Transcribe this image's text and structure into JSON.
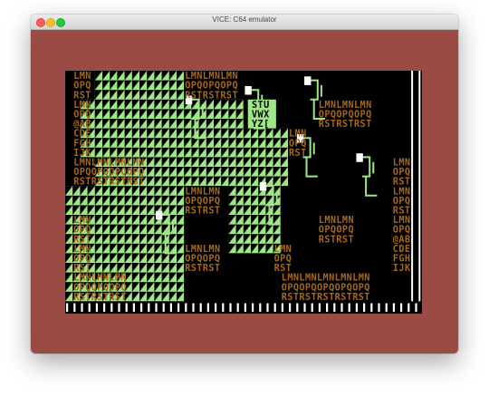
{
  "window": {
    "title": "VICE: C64 emulator"
  },
  "colors": {
    "border": "#9a4b44",
    "screen": "#000000",
    "tile": "#9fe686",
    "text": "#a6671a",
    "box_text": "#000000"
  },
  "icons": [
    "close-icon",
    "minimize-icon",
    "zoom-icon"
  ],
  "texts": [
    {
      "t": "LMN",
      "x": 1,
      "y": 0
    },
    {
      "t": "OPQ",
      "x": 1,
      "y": 1
    },
    {
      "t": "RST",
      "x": 1,
      "y": 2
    },
    {
      "t": "LMN",
      "x": 1,
      "y": 3
    },
    {
      "t": "OPQ",
      "x": 1,
      "y": 4
    },
    {
      "t": "@AB",
      "x": 1,
      "y": 5
    },
    {
      "t": "CDE",
      "x": 1,
      "y": 6
    },
    {
      "t": "FGH",
      "x": 1,
      "y": 7
    },
    {
      "t": "IJK",
      "x": 1,
      "y": 8
    },
    {
      "t": "LMNLMNLMNLMN",
      "x": 1,
      "y": 9
    },
    {
      "t": "OPQOPQOPQOPQ",
      "x": 1,
      "y": 10
    },
    {
      "t": "RSTRSTRSTRST",
      "x": 1,
      "y": 11
    },
    {
      "t": "LMN",
      "x": 1,
      "y": 15
    },
    {
      "t": "OPQ",
      "x": 1,
      "y": 16
    },
    {
      "t": "RST",
      "x": 1,
      "y": 17
    },
    {
      "t": "LMN",
      "x": 1,
      "y": 18
    },
    {
      "t": "OPQ",
      "x": 1,
      "y": 19
    },
    {
      "t": "RST",
      "x": 1,
      "y": 20
    },
    {
      "t": "LMNLMNLMN",
      "x": 1,
      "y": 21
    },
    {
      "t": "OPQOPQOPQ",
      "x": 1,
      "y": 22
    },
    {
      "t": "RSTRSTRST",
      "x": 1,
      "y": 23
    },
    {
      "t": "LMNLMNLMN",
      "x": 16,
      "y": 0
    },
    {
      "t": "OPQOPQOPQ",
      "x": 16,
      "y": 1
    },
    {
      "t": "RSTRSTRST",
      "x": 16,
      "y": 2
    },
    {
      "t": "LMNLMNLMN",
      "x": 34,
      "y": 3
    },
    {
      "t": "OPQOPQOPQ",
      "x": 34,
      "y": 4
    },
    {
      "t": "RSTRSTRST",
      "x": 34,
      "y": 5
    },
    {
      "t": "LMN",
      "x": 30,
      "y": 6
    },
    {
      "t": "OPQ",
      "x": 30,
      "y": 7
    },
    {
      "t": "RST",
      "x": 30,
      "y": 8
    },
    {
      "t": "LMNLMN",
      "x": 16,
      "y": 12
    },
    {
      "t": "OPQOPQ",
      "x": 16,
      "y": 13
    },
    {
      "t": "RSTRST",
      "x": 16,
      "y": 14
    },
    {
      "t": "LMNLMN",
      "x": 16,
      "y": 18
    },
    {
      "t": "OPQOPQ",
      "x": 16,
      "y": 19
    },
    {
      "t": "RSTRST",
      "x": 16,
      "y": 20
    },
    {
      "t": "LMN",
      "x": 28,
      "y": 18
    },
    {
      "t": "OPQ",
      "x": 28,
      "y": 19
    },
    {
      "t": "RST",
      "x": 28,
      "y": 20
    },
    {
      "t": "LMNLMN",
      "x": 34,
      "y": 15
    },
    {
      "t": "OPQOPQ",
      "x": 34,
      "y": 16
    },
    {
      "t": "RSTRST",
      "x": 34,
      "y": 17
    },
    {
      "t": "LMN",
      "x": 44,
      "y": 9
    },
    {
      "t": "OPQ",
      "x": 44,
      "y": 10
    },
    {
      "t": "RST",
      "x": 44,
      "y": 11
    },
    {
      "t": "LMN",
      "x": 44,
      "y": 12
    },
    {
      "t": "OPQ",
      "x": 44,
      "y": 13
    },
    {
      "t": "RST",
      "x": 44,
      "y": 14
    },
    {
      "t": "LMN",
      "x": 44,
      "y": 15
    },
    {
      "t": "OPQ",
      "x": 44,
      "y": 16
    },
    {
      "t": "@AB",
      "x": 44,
      "y": 17
    },
    {
      "t": "CDE",
      "x": 44,
      "y": 18
    },
    {
      "t": "FGH",
      "x": 44,
      "y": 19
    },
    {
      "t": "IJK",
      "x": 44,
      "y": 20
    },
    {
      "t": "LMNLMNLMNLMNLMN",
      "x": 29,
      "y": 21
    },
    {
      "t": "OPQOPQOPQOPQOPQ",
      "x": 29,
      "y": 22
    },
    {
      "t": "RSTRSTRSTRSTRST",
      "x": 29,
      "y": 23
    }
  ],
  "box_texts": [
    {
      "t": "STU",
      "x": 25,
      "y": 3
    },
    {
      "t": "VWX",
      "x": 25,
      "y": 4
    },
    {
      "t": "YZ[",
      "x": 25,
      "y": 5
    }
  ]
}
